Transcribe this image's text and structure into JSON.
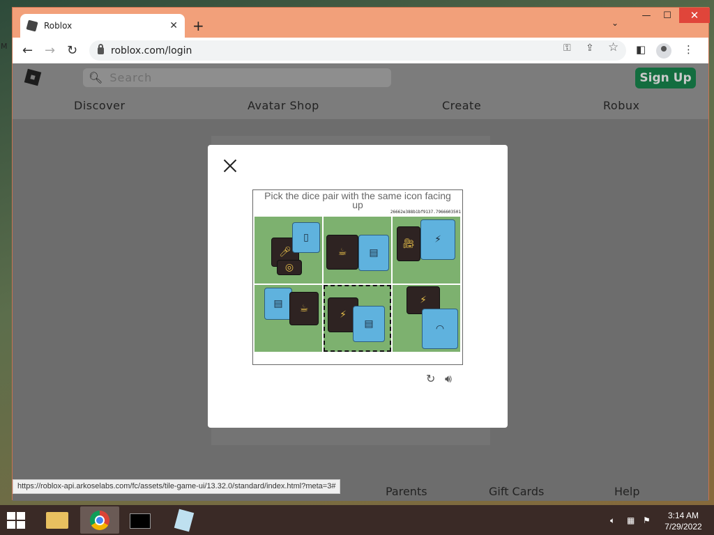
{
  "desktop": {
    "edge_label": "M"
  },
  "browser": {
    "tab_title": "Roblox",
    "url": "roblox.com/login",
    "status_url": "https://roblox-api.arkoselabs.com/fc/assets/tile-game-ui/13.32.0/standard/index.html?meta=3#",
    "window_close_color": "#e0453a"
  },
  "roblox": {
    "search_placeholder": "Search",
    "signup_label": "Sign Up",
    "nav": [
      "Discover",
      "Avatar Shop",
      "Create",
      "Robux"
    ],
    "footer": [
      "Parents",
      "Gift Cards",
      "Help"
    ],
    "brand_green": "#136d3f"
  },
  "captcha": {
    "prompt": "Pick the dice pair with the same icon facing up",
    "game_id": "26662e388b1bf9137.7966603501",
    "tiles": [
      {
        "label": "tile-1",
        "selected": false
      },
      {
        "label": "tile-2",
        "selected": false
      },
      {
        "label": "tile-3",
        "selected": false
      },
      {
        "label": "tile-4",
        "selected": false
      },
      {
        "label": "tile-5",
        "selected": true
      },
      {
        "label": "tile-6",
        "selected": false
      }
    ]
  },
  "taskbar": {
    "time": "3:14 AM",
    "date": "7/29/2022"
  }
}
